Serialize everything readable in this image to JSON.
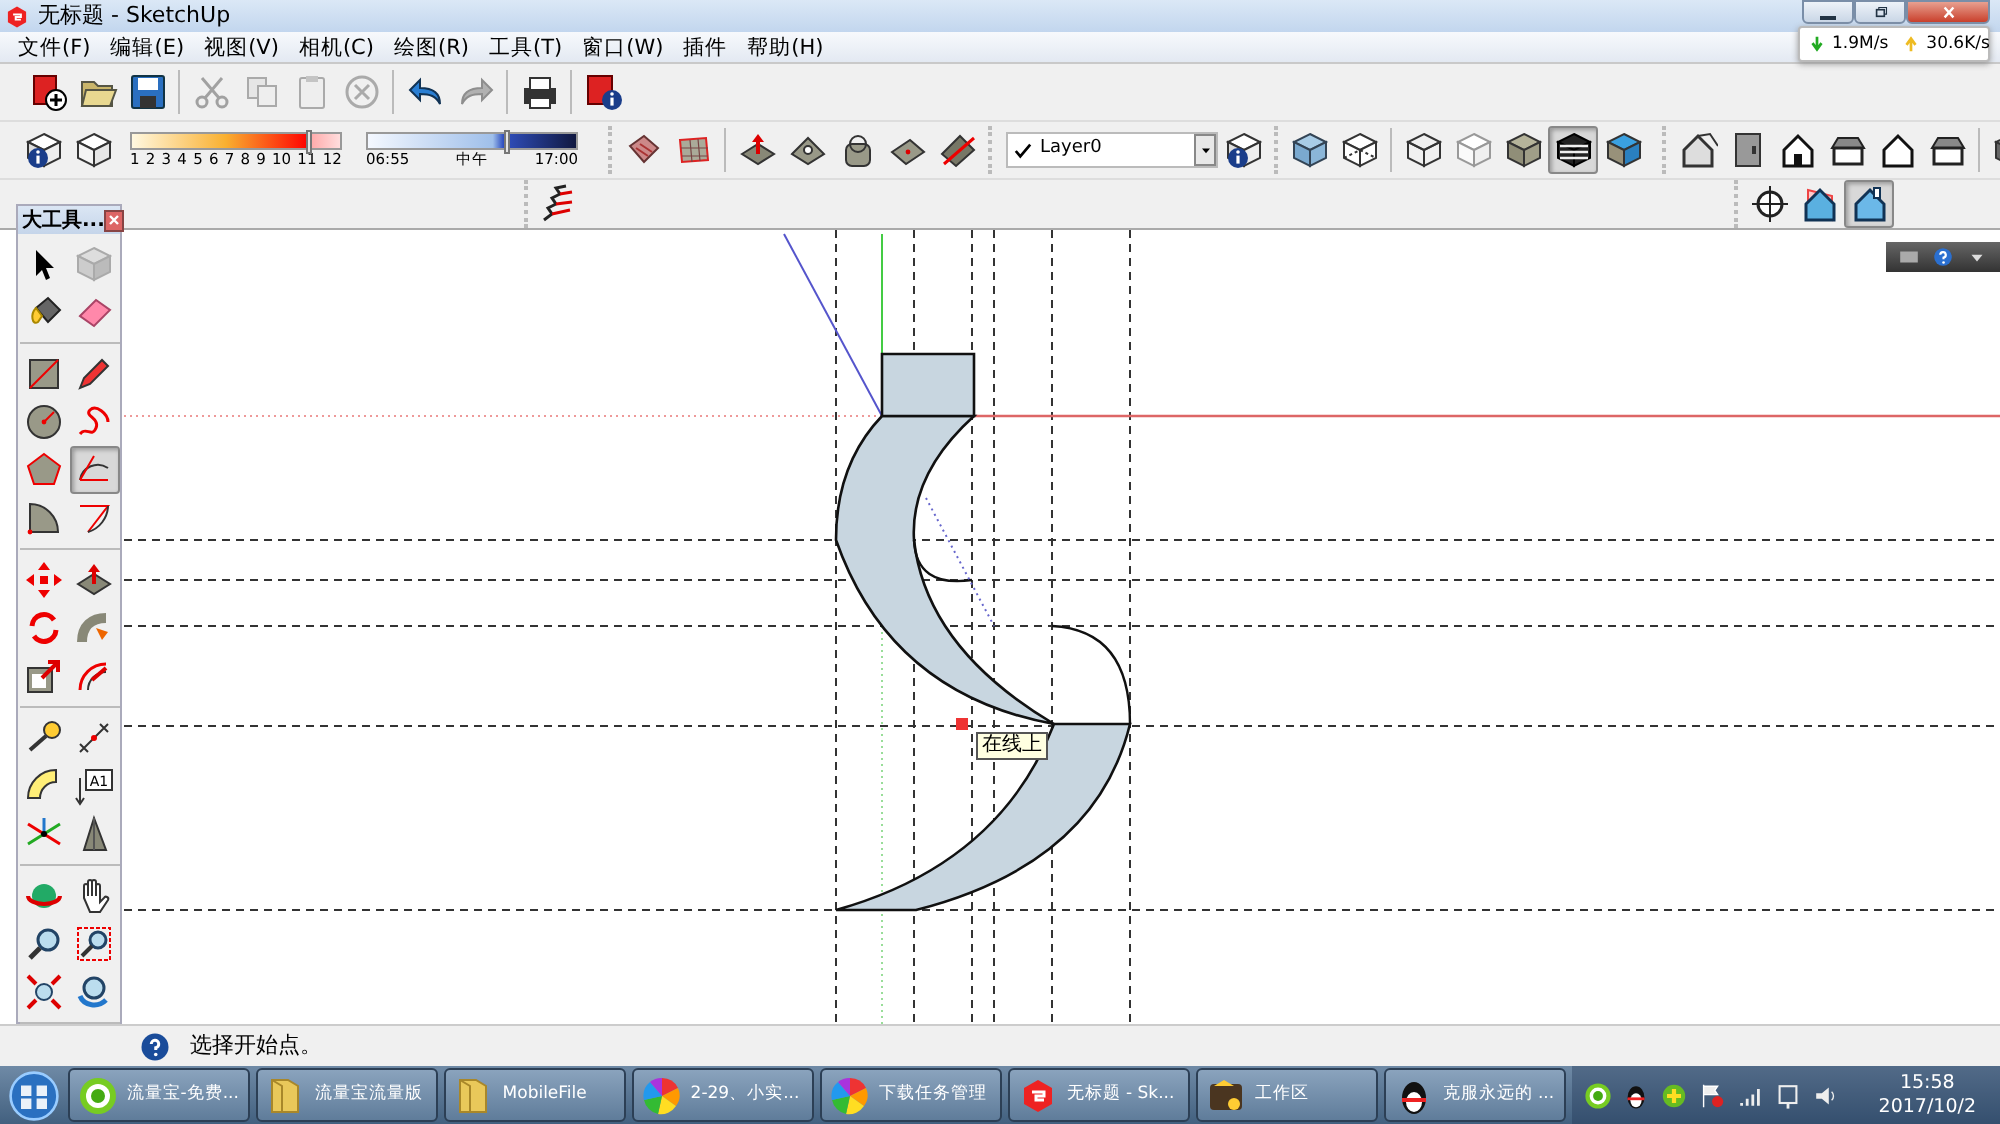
{
  "window": {
    "title": "无标题 - SketchUp"
  },
  "net_speed": {
    "download": "1.9M/s",
    "upload": "30.6K/s"
  },
  "menu": [
    "文件(F)",
    "编辑(E)",
    "视图(V)",
    "相机(C)",
    "绘图(R)",
    "工具(T)",
    "窗口(W)",
    "插件",
    "帮助(H)"
  ],
  "standard_toolbar": [
    [
      {
        "kind": "new",
        "disabled": false
      },
      {
        "kind": "open",
        "disabled": false
      },
      {
        "kind": "save",
        "disabled": false
      }
    ],
    [
      {
        "kind": "cut",
        "disabled": true
      },
      {
        "kind": "copy",
        "disabled": true
      },
      {
        "kind": "paste",
        "disabled": true
      },
      {
        "kind": "delete",
        "disabled": true
      }
    ],
    [
      {
        "kind": "undo",
        "disabled": false
      },
      {
        "kind": "redo",
        "disabled": true
      }
    ],
    [
      {
        "kind": "print",
        "disabled": false
      }
    ],
    [
      {
        "kind": "model_info",
        "disabled": false
      }
    ]
  ],
  "shadow_toolbar": {
    "buttons": [
      {
        "kind": "entity_info"
      },
      {
        "kind": "shadow"
      }
    ],
    "months": [
      "1",
      "2",
      "3",
      "4",
      "5",
      "6",
      "7",
      "8",
      "9",
      "10",
      "11",
      "12"
    ],
    "month_slider": {
      "level": 0.86
    },
    "time_start": "06:55",
    "time_noon": "中午",
    "time_end": "17:00",
    "time_slider": {
      "level": 0.67
    }
  },
  "section_toolbar": [
    [
      {
        "kind": "tile"
      },
      {
        "kind": "grid_plane"
      }
    ],
    [
      {
        "kind": "push_pull"
      },
      {
        "kind": "pyramid"
      },
      {
        "kind": "bag"
      },
      {
        "kind": "dot_tile"
      },
      {
        "kind": "slash_tile"
      }
    ]
  ],
  "layer": {
    "name": "Layer0",
    "current": true
  },
  "style_toolbar": [
    [
      {
        "kind": "xray",
        "selected": false
      },
      {
        "kind": "back_edges",
        "selected": false
      }
    ],
    [
      {
        "kind": "wireframe",
        "selected": false
      },
      {
        "kind": "hidden_line",
        "selected": false
      },
      {
        "kind": "shaded",
        "selected": false
      },
      {
        "kind": "textured",
        "selected": true
      },
      {
        "kind": "monochrome",
        "selected": false
      }
    ]
  ],
  "views_toolbar": [
    [
      {
        "kind": "iso_house"
      },
      {
        "kind": "door"
      },
      {
        "kind": "house"
      },
      {
        "kind": "roof_box"
      },
      {
        "kind": "house_outline"
      },
      {
        "kind": "roof_box"
      }
    ],
    [
      {
        "kind": "boxes"
      }
    ]
  ],
  "sandbox_toolbar": [
    {
      "kind": "mesh"
    }
  ],
  "camera_toolbar": [
    {
      "kind": "crosshair",
      "selected": false
    },
    {
      "kind": "section_house",
      "selected": false
    },
    {
      "kind": "house_blue",
      "selected": true
    }
  ],
  "toolbox": {
    "title": "大工具...",
    "groups": [
      [
        {
          "kind": "select",
          "selected": false
        },
        {
          "kind": "component",
          "selected": false
        },
        {
          "kind": "paint",
          "selected": false
        },
        {
          "kind": "eraser",
          "selected": false
        }
      ],
      [
        {
          "kind": "rectangle",
          "selected": false
        },
        {
          "kind": "pencil",
          "selected": false
        },
        {
          "kind": "circle",
          "selected": false
        },
        {
          "kind": "freehand",
          "selected": false
        },
        {
          "kind": "polygon",
          "selected": false
        },
        {
          "kind": "arc",
          "selected": true
        },
        {
          "kind": "pie",
          "selected": false
        },
        {
          "kind": "arc2",
          "selected": false
        }
      ],
      [
        {
          "kind": "move",
          "selected": false
        },
        {
          "kind": "pushpull",
          "selected": false
        },
        {
          "kind": "rotate",
          "selected": false
        },
        {
          "kind": "followme",
          "selected": false
        },
        {
          "kind": "scale",
          "selected": false
        },
        {
          "kind": "offset",
          "selected": false
        }
      ],
      [
        {
          "kind": "tape",
          "selected": false
        },
        {
          "kind": "dimension",
          "selected": false
        },
        {
          "kind": "protractor",
          "selected": false
        },
        {
          "kind": "text",
          "selected": false,
          "label": "A1"
        },
        {
          "kind": "axes",
          "selected": false
        },
        {
          "kind": "text3d",
          "selected": false
        }
      ],
      [
        {
          "kind": "orbit",
          "selected": false
        },
        {
          "kind": "pan",
          "selected": false
        },
        {
          "kind": "zoom",
          "selected": false
        },
        {
          "kind": "zoomwin",
          "selected": false
        },
        {
          "kind": "extents",
          "selected": false
        },
        {
          "kind": "previous",
          "selected": false
        }
      ]
    ]
  },
  "canvas": {
    "tooltip": "在线上"
  },
  "status_bar": {
    "text": "选择开始点。"
  },
  "taskbar": {
    "items": [
      {
        "kind": "green_app",
        "label": "流量宝-免费..."
      },
      {
        "kind": "folder",
        "label": "流量宝流量版"
      },
      {
        "kind": "folder",
        "label": "MobileFile"
      },
      {
        "kind": "pinwheel",
        "label": "2-29、小实..."
      },
      {
        "kind": "pinwheel",
        "label": "下载任务管理"
      },
      {
        "kind": "sketchup",
        "label": "无标题 - Sk..."
      },
      {
        "kind": "wallet",
        "label": "工作区"
      },
      {
        "kind": "penguin",
        "label": "克服永远的 ..."
      }
    ],
    "time": "15:58",
    "date": "2017/10/2"
  }
}
